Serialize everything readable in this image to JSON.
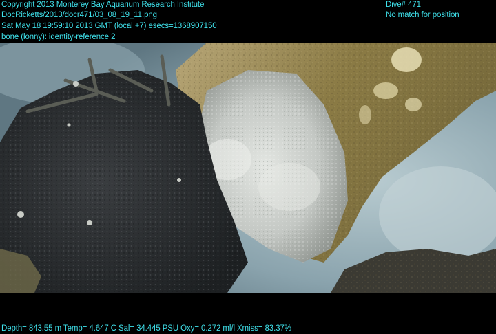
{
  "overlay": {
    "copyright": "Copyright 2013 Monterey Bay Aquarium Research Institute",
    "file_path": "DocRicketts/2013/docr471/03_08_19_11.png",
    "timestamp": "Sat May 18 19:59:10 2013 GMT (local +7)  esecs=1368907150",
    "subject": "bone (lonny): identity-reference 2",
    "dive": "Dive# 471",
    "position_status": "No match for position",
    "telemetry": "Depth= 843.55 m  Temp= 4.647 C  Sal= 34.445 PSU  Oxy= 0.272 ml/l  Xmiss= 83.37%"
  },
  "colors": {
    "overlay_text": "#3fe0ea",
    "background": "#000000",
    "water": "#7f9aa6",
    "bone": "#8a7a45",
    "mat_white": "#d9dcd8",
    "sediment_dark": "#2c2f32"
  }
}
